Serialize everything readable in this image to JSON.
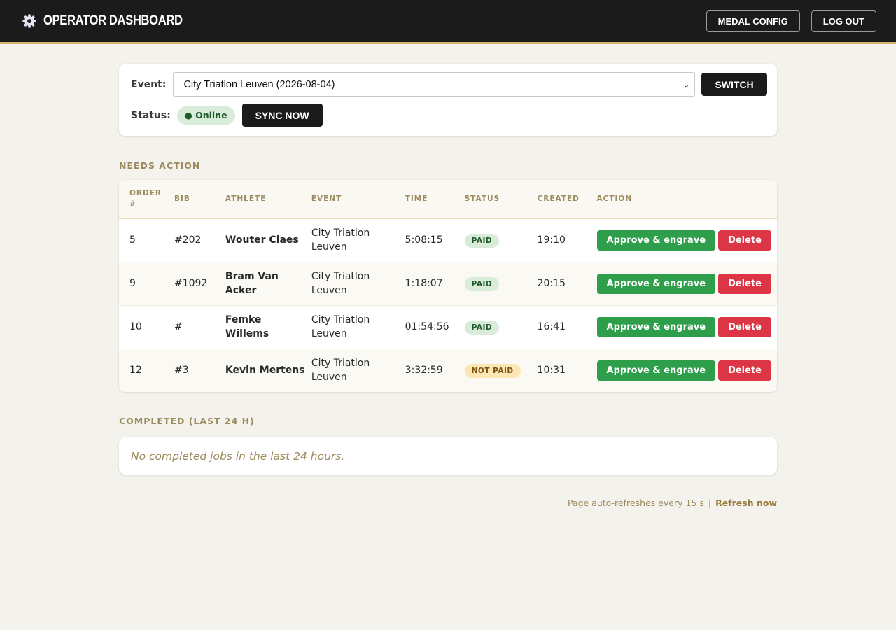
{
  "header": {
    "title": "OPERATOR DASHBOARD",
    "medal_config_label": "MEDAL CONFIG",
    "logout_label": "LOG OUT"
  },
  "event_panel": {
    "event_label": "Event:",
    "selected_event": "City Triatlon Leuven (2026-08-04)",
    "switch_label": "SWITCH",
    "status_label": "Status:",
    "status_value": "● Online",
    "sync_label": "SYNC NOW"
  },
  "needs_action": {
    "title": "NEEDS ACTION",
    "columns": [
      "ORDER #",
      "BIB",
      "ATHLETE",
      "EVENT",
      "TIME",
      "STATUS",
      "CREATED",
      "ACTION"
    ],
    "rows": [
      {
        "order": "5",
        "bib": "#202",
        "athlete": "Wouter Claes",
        "event": "City Triatlon Leuven",
        "time": "5:08:15",
        "status": "PAID",
        "created": "19:10",
        "approve": "Approve & engrave",
        "delete": "Delete"
      },
      {
        "order": "9",
        "bib": "#1092",
        "athlete": "Bram Van Acker",
        "event": "City Triatlon Leuven",
        "time": "1:18:07",
        "status": "PAID",
        "created": "20:15",
        "approve": "Approve & engrave",
        "delete": "Delete"
      },
      {
        "order": "10",
        "bib": "#",
        "athlete": "Femke Willems",
        "event": "City Triatlon Leuven",
        "time": "01:54:56",
        "status": "PAID",
        "created": "16:41",
        "approve": "Approve & engrave",
        "delete": "Delete"
      },
      {
        "order": "12",
        "bib": "#3",
        "athlete": "Kevin Mertens",
        "event": "City Triatlon Leuven",
        "time": "3:32:59",
        "status": "NOT PAID",
        "created": "10:31",
        "approve": "Approve & engrave",
        "delete": "Delete"
      }
    ]
  },
  "completed": {
    "title": "COMPLETED (LAST 24 H)",
    "empty_text": "No completed jobs in the last 24 hours."
  },
  "footer": {
    "auto_refresh_text": "Page auto-refreshes every 15 s",
    "separator": "|",
    "refresh_link": "Refresh now"
  },
  "colors": {
    "accent": "#d4b36a",
    "approve": "#2e9e4a",
    "delete": "#dc3545"
  },
  "icons": {
    "brand": "gear-icon",
    "select": "chevron-down-icon"
  }
}
